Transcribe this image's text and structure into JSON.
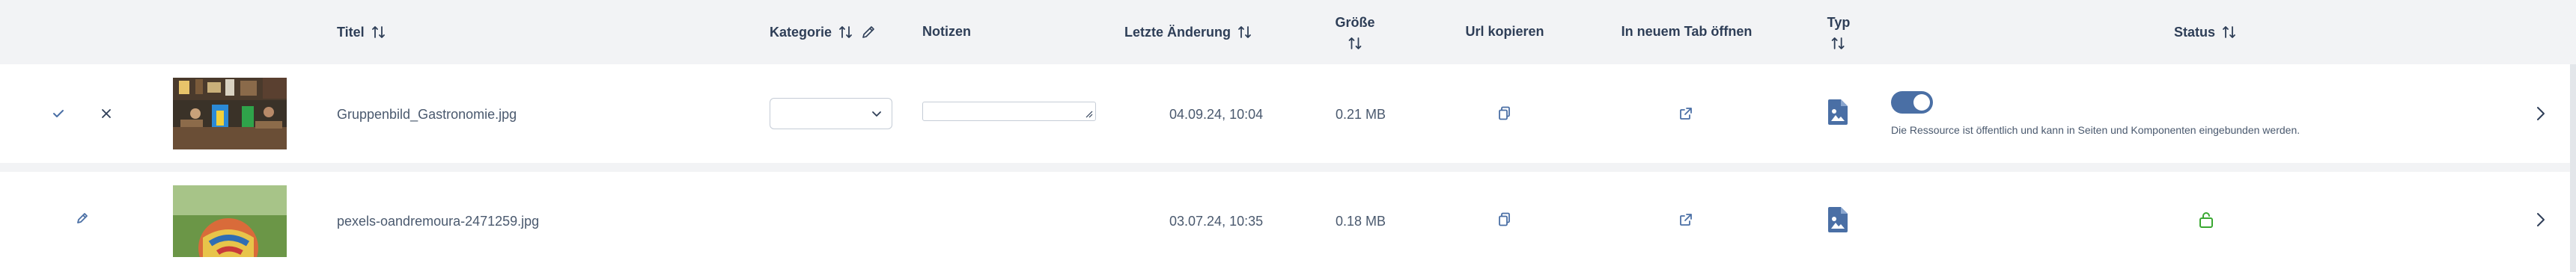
{
  "columns": {
    "title": "Titel",
    "category": "Kategorie",
    "notes": "Notizen",
    "last_modified": "Letzte Änderung",
    "size": "Größe",
    "copy_url": "Url kopieren",
    "open_new_tab": "In neuem Tab öffnen",
    "type": "Typ",
    "status": "Status"
  },
  "rows": [
    {
      "title": "Gruppenbild_Gastronomie.jpg",
      "category_value": "",
      "notes_value": "",
      "date": "04.09.24, 10:04",
      "size": "0.21 MB",
      "status_toggle_on": true,
      "status_text": "Die Ressource ist öffentlich und kann in Seiten und Komponenten eingebunden werden."
    },
    {
      "title": "pexels-oandremoura-2471259.jpg",
      "date": "03.07.24, 10:35",
      "size": "0.18 MB",
      "status_icon": "unlocked-icon"
    }
  ],
  "colors": {
    "accent": "#4a6fa5",
    "unlocked": "#3aa832",
    "header_bg": "#f2f3f5"
  }
}
